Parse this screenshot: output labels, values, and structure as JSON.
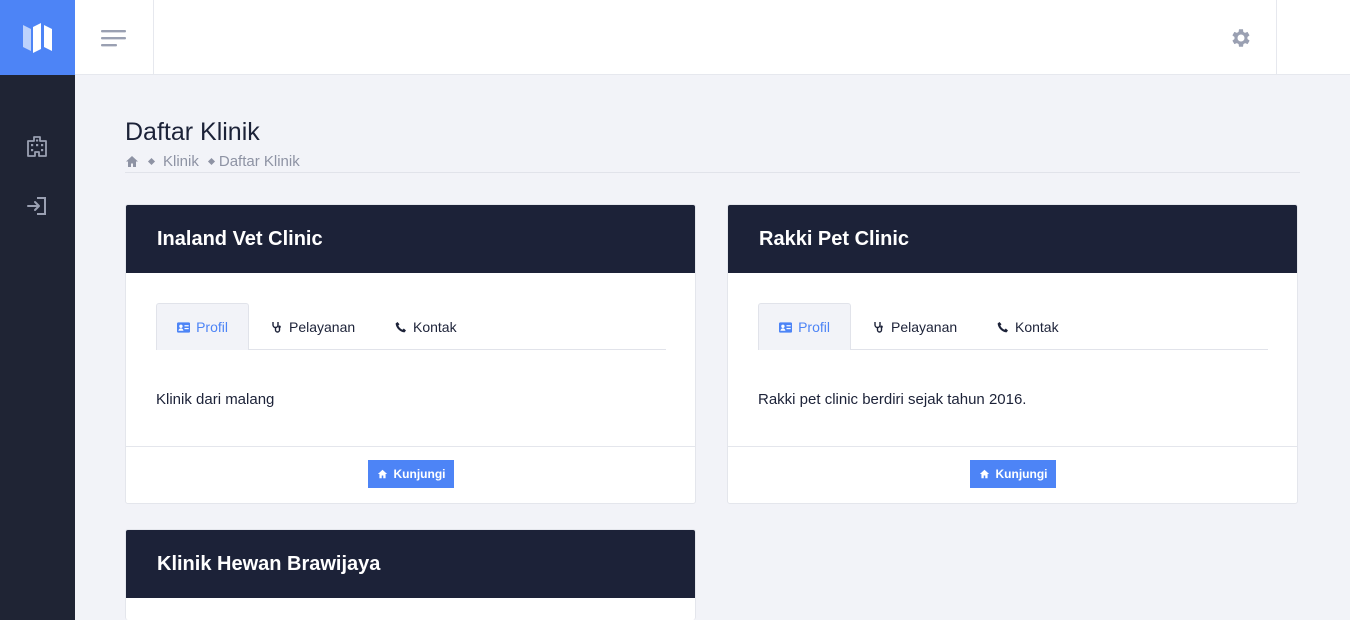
{
  "header": {
    "menu_icon": "hamburger-icon",
    "settings_icon": "gear-icon"
  },
  "sidebar": {
    "logo_icon": "app-logo",
    "items": [
      {
        "icon": "building-icon"
      },
      {
        "icon": "sign-in-icon"
      }
    ]
  },
  "page": {
    "title": "Daftar Klinik",
    "breadcrumb": [
      "Klinik",
      "Daftar Klinik"
    ]
  },
  "clinics": [
    {
      "name": "Inaland Vet Clinic",
      "tabs": [
        "Profil",
        "Pelayanan",
        "Kontak"
      ],
      "active_tab": "Profil",
      "description": "Klinik dari malang",
      "button": "Kunjungi"
    },
    {
      "name": "Rakki Pet Clinic",
      "tabs": [
        "Profil",
        "Pelayanan",
        "Kontak"
      ],
      "active_tab": "Profil",
      "description": "Rakki pet clinic berdiri sejak tahun 2016.",
      "button": "Kunjungi"
    },
    {
      "name": "Klinik Hewan Brawijaya"
    }
  ],
  "colors": {
    "primary": "#4d84f6",
    "sidebar": "#1f2434",
    "card_header": "#1c2238",
    "background": "#f2f3f8"
  }
}
